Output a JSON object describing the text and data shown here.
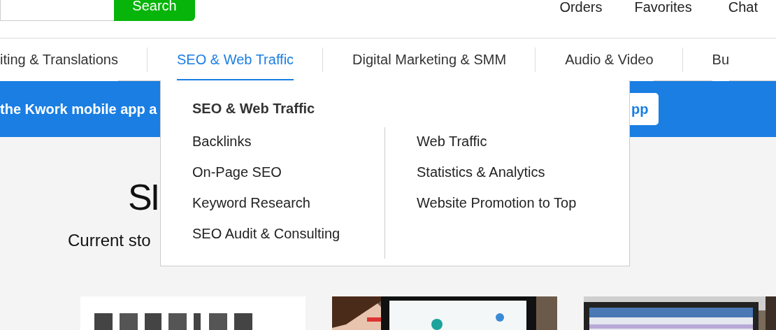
{
  "header": {
    "search_button": "Search",
    "links": [
      {
        "label": "Orders"
      },
      {
        "label": "Favorites"
      },
      {
        "label": "Chat"
      }
    ]
  },
  "categories": [
    {
      "label": "iting & Translations",
      "selected": false
    },
    {
      "label": "SEO & Web Traffic",
      "selected": true
    },
    {
      "label": "Digital Marketing & SMM",
      "selected": false
    },
    {
      "label": "Audio & Video",
      "selected": false
    },
    {
      "label": "Bu",
      "selected": false
    }
  ],
  "banner": {
    "text": "the Kwork mobile app a",
    "button": "pp"
  },
  "dropdown": {
    "title": "SEO & Web Traffic",
    "columns": [
      [
        "Backlinks",
        "On-Page SEO",
        "Keyword Research",
        "SEO Audit & Consulting"
      ],
      [
        "Web Traffic",
        "Statistics & Analytics",
        "Website Promotion to Top"
      ]
    ]
  },
  "hero": {
    "title": "SI",
    "subtitle": "Current sto"
  }
}
